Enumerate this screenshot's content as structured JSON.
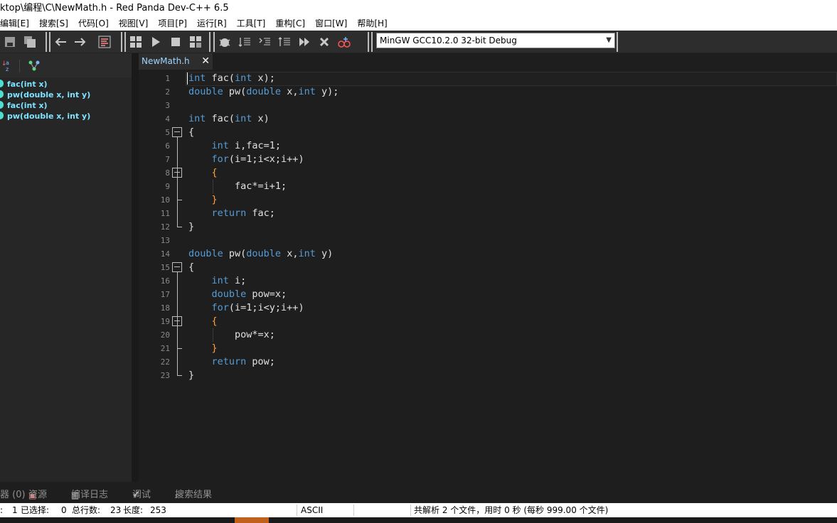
{
  "window": {
    "title": "ktop\\编程\\C\\NewMath.h - Red Panda Dev-C++ 6.5"
  },
  "menu": [
    "编辑[E]",
    "搜索[S]",
    "代码[O]",
    "视图[V]",
    "项目[P]",
    "运行[R]",
    "工具[T]",
    "重构[C]",
    "窗口[W]",
    "帮助[H]"
  ],
  "compiler": {
    "selected": "MinGW GCC10.2.0 32-bit Debug"
  },
  "class_browser": {
    "items": [
      "fac(int x)",
      "pw(double x, int y)",
      "fac(int x)",
      "pw(double x, int y)"
    ]
  },
  "editor": {
    "tab_label": "NewMath.h",
    "line_numbers": [
      "1",
      "2",
      "3",
      "4",
      "5",
      "6",
      "7",
      "8",
      "9",
      "10",
      "11",
      "12",
      "13",
      "14",
      "15",
      "16",
      "17",
      "18",
      "19",
      "20",
      "21",
      "22",
      "23"
    ]
  },
  "bottom_tabs": {
    "messages": "器 (0)",
    "resources": "资源",
    "compile_log": "编译日志",
    "debug": "调试",
    "search_results": "搜索结果"
  },
  "status": {
    "line_prefix": ":",
    "line": "1",
    "selected_label": "已选择:",
    "selected": "0",
    "total_label": "总行数:",
    "total": "23",
    "length_label": "长度:",
    "length": "253",
    "encoding": "ASCII",
    "parse_info": "共解析 2 个文件，用时 0 秒 (每秒 999.00 个文件)"
  },
  "colors": {
    "keyword": "#569cd6",
    "brace": "#ff9e3b",
    "text": "#e0e0e0",
    "tab_text": "#9fd5ff",
    "class_item": "#7ee3ff"
  }
}
